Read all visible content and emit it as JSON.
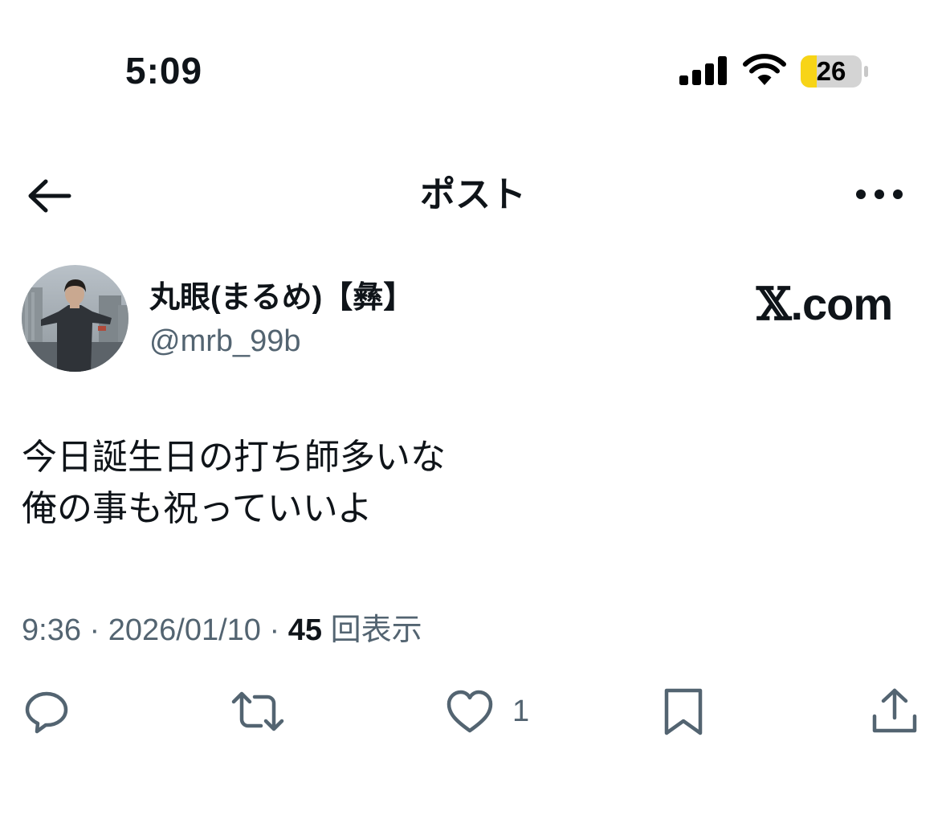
{
  "status_bar": {
    "time": "5:09",
    "battery_level": "26",
    "battery_color": "#f7d417"
  },
  "header": {
    "title": "ポスト",
    "back_icon": "arrow-left-icon",
    "more_icon": "more-horizontal-icon"
  },
  "post": {
    "author": {
      "display_name": "丸眼(まるめ)【彝】",
      "handle": "@mrb_99b"
    },
    "watermark": {
      "x": "𝕏",
      "rest": ".com"
    },
    "lines": [
      "今日誕生日の打ち師多いな",
      "俺の事も祝っていいよ"
    ],
    "meta": {
      "time": "9:36",
      "separator": "·",
      "date": "2026/01/10",
      "views_count": "45",
      "views_label": "回表示"
    },
    "actions": {
      "likes": "1"
    }
  },
  "colors": {
    "text": "#0f1419",
    "secondary": "#536471",
    "icon": "#536471"
  }
}
